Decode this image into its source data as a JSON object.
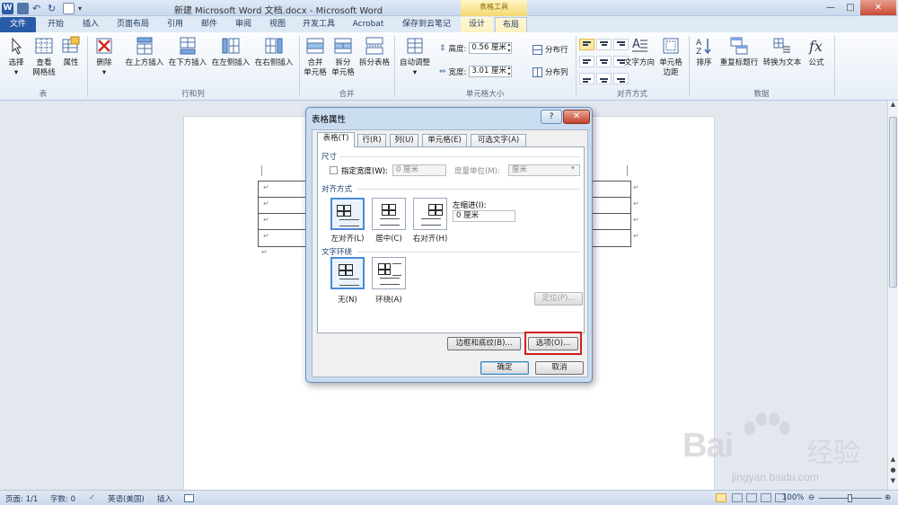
{
  "window": {
    "title": "新建 Microsoft Word 文档.docx - Microsoft Word",
    "context_tab_group": "表格工具",
    "minimize": "—",
    "maximize": "□",
    "close": "✕"
  },
  "tabs": [
    "文件",
    "开始",
    "插入",
    "页面布局",
    "引用",
    "邮件",
    "审阅",
    "视图",
    "开发工具",
    "Acrobat",
    "保存到云笔记",
    "设计",
    "布局"
  ],
  "ribbon": {
    "groups": {
      "table": "表",
      "rows_cols": "行和列",
      "merge": "合并",
      "cell_size": "单元格大小",
      "alignment": "对齐方式",
      "data": "数据"
    },
    "buttons": {
      "select": "选择",
      "gridlines_1": "查看",
      "gridlines_2": "网格线",
      "properties": "属性",
      "delete": "删除",
      "insert_above": "在上方插入",
      "insert_below": "在下方插入",
      "insert_left": "在左侧插入",
      "insert_right": "在右侧插入",
      "merge_1": "合并",
      "merge_2": "单元格",
      "split_1": "拆分",
      "split_2": "单元格",
      "split_table": "拆分表格",
      "autofit": "自动调整",
      "height_label": "高度:",
      "height_value": "0.56 厘米",
      "width_label": "宽度:",
      "width_value": "3.01 厘米",
      "distribute_rows": "分布行",
      "distribute_cols": "分布列",
      "text_direction": "文字方向",
      "cell_margins_1": "单元格",
      "cell_margins_2": "边距",
      "sort": "排序",
      "repeat_header": "重复标题行",
      "convert_text": "转换为文本",
      "formula": "公式"
    }
  },
  "dialog": {
    "title": "表格属性",
    "help": "?",
    "close": "✕",
    "tabs": [
      "表格(T)",
      "行(R)",
      "列(U)",
      "单元格(E)",
      "可选文字(A)"
    ],
    "size_section": "尺寸",
    "preferred_width_label": "指定宽度(W):",
    "preferred_width_value": "0 厘米",
    "measure_in_label": "度量单位(M):",
    "measure_in_value": "厘米",
    "alignment_section": "对齐方式",
    "indent_label": "左缩进(I):",
    "indent_value": "0 厘米",
    "align_options": [
      "左对齐(L)",
      "居中(C)",
      "右对齐(H)"
    ],
    "wrap_section": "文字环绕",
    "wrap_options": [
      "无(N)",
      "环绕(A)"
    ],
    "positioning_button": "定位(P)...",
    "borders_button": "边框和底纹(B)...",
    "options_button": "选项(O)...",
    "ok_button": "确定",
    "cancel_button": "取消"
  },
  "document": {
    "paragraph_mark": "↵"
  },
  "status": {
    "page": "页面: 1/1",
    "words": "字数: 0",
    "language": "英语(美国)",
    "mode": "插入",
    "zoom": "100%"
  },
  "watermark": {
    "brand": "Bai",
    "brand_suffix": "经验",
    "url": "jingyan.baidu.com"
  },
  "colors": {
    "file_tab": "#2a5ba8",
    "highlight_box": "#d21f1f",
    "context_tab": "#f5d873"
  }
}
